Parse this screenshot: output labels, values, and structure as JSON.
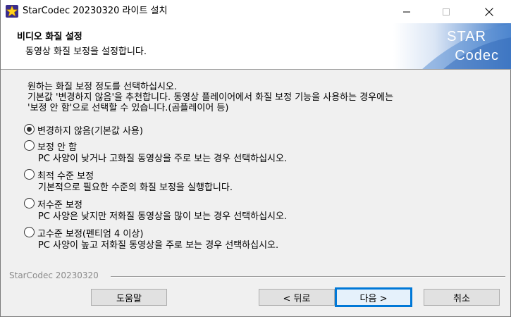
{
  "window": {
    "title": "StarCodec 20230320 라이트 설치"
  },
  "header": {
    "title": "비디오 화질 설정",
    "subtitle": "동영상 화질 보정을 설정합니다.",
    "banner_line1": "STAR",
    "banner_line2": "Codec"
  },
  "description": {
    "line1": "원하는 화질 보정 정도를 선택하십시오.",
    "line2": "기본값 '변경하지 않음'을 추천합니다. 동영상 플레이어에서 화질 보정 기능을 사용하는 경우에는",
    "line3": "'보정 안 함'으로 선택할 수 있습니다.(곰플레이어 등)"
  },
  "options": [
    {
      "label": "변경하지 않음(기본값 사용)",
      "desc": "",
      "checked": true
    },
    {
      "label": "보정 안 함",
      "desc": "PC 사양이 낮거나 고화질 동영상을 주로 보는 경우 선택하십시오.",
      "checked": false
    },
    {
      "label": "최적 수준 보정",
      "desc": "기본적으로 필요한 수준의 화질 보정을 실행합니다.",
      "checked": false
    },
    {
      "label": "저수준 보정",
      "desc": "PC 사양은 낮지만 저화질 동영상을 많이 보는 경우 선택하십시오.",
      "checked": false
    },
    {
      "label": "고수준 보정(펜티엄 4 이상)",
      "desc": "PC 사양이 높고 저화질 동영상을 주로 보는 경우 선택하십시오.",
      "checked": false
    }
  ],
  "footer": {
    "brand": "StarCodec 20230320",
    "help_label": "도움말",
    "back_label": "< 뒤로",
    "next_label": "다음 >",
    "cancel_label": "취소"
  },
  "colors": {
    "accent": "#0078d7",
    "banner_start": "#ffffff",
    "banner_end": "#3b78c8"
  },
  "icons": {
    "app": "star-icon",
    "minimize": "minimize-icon",
    "maximize": "maximize-icon",
    "close": "close-icon"
  }
}
